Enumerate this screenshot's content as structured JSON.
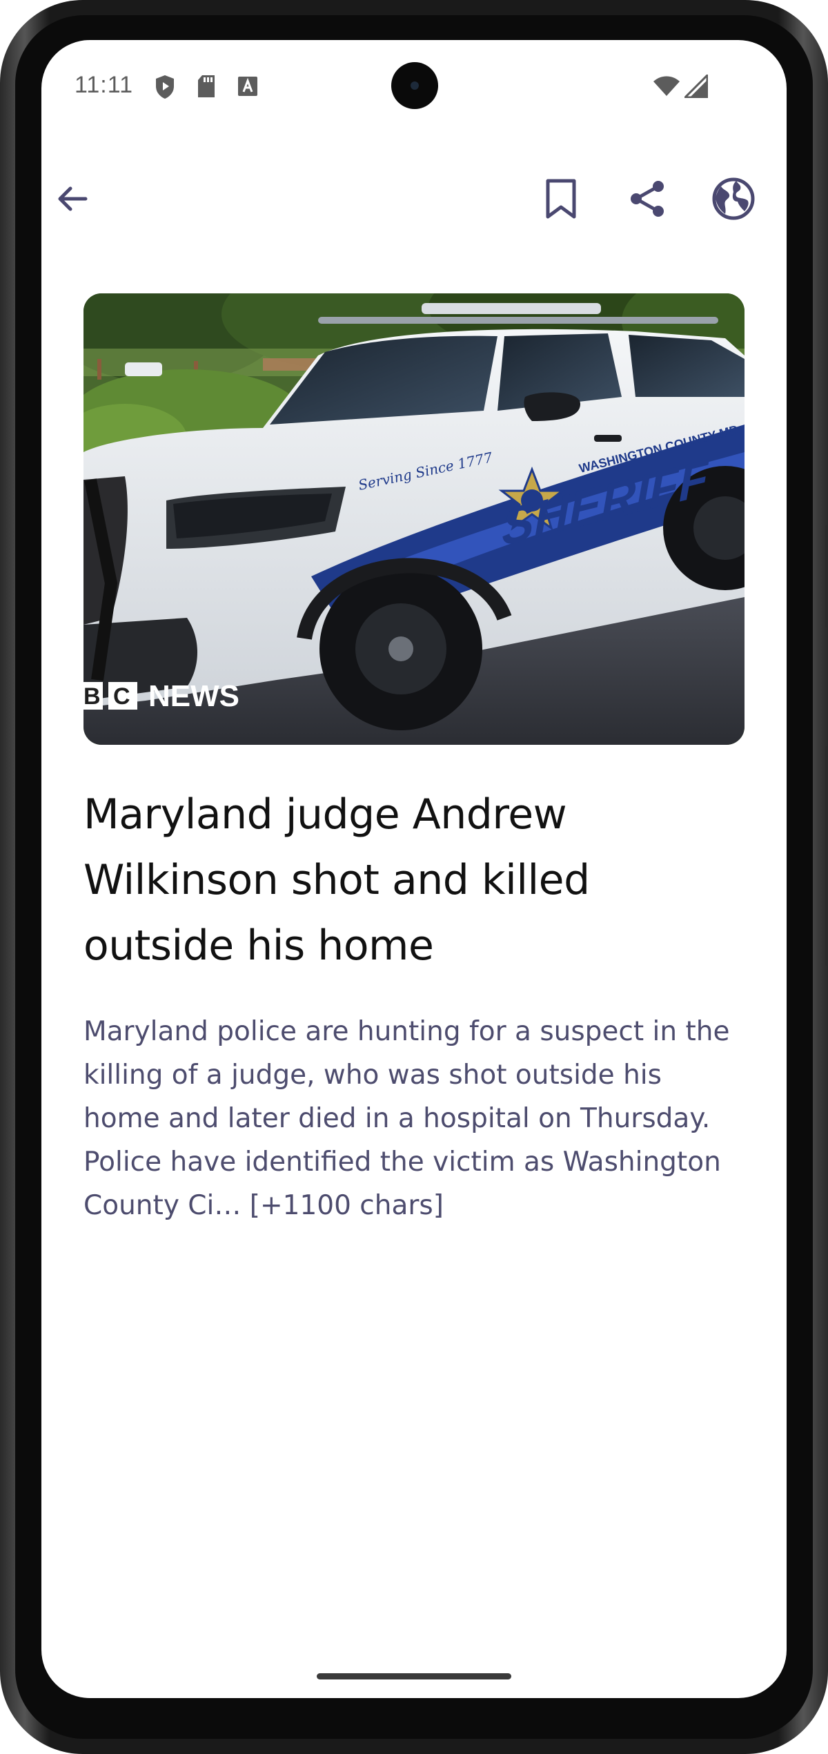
{
  "status_bar": {
    "time": "11:11",
    "left_icons": [
      "shield-icon",
      "sd-card-icon",
      "font-a-icon"
    ],
    "right_icons": [
      "wifi-icon",
      "cellular-signal-icon"
    ]
  },
  "app_bar": {
    "back_icon": "arrow-back-icon",
    "actions": [
      "bookmark-icon",
      "share-icon",
      "globe-icon"
    ]
  },
  "article": {
    "image_watermark": "B C NEWS",
    "image_badge_letters": [
      "B",
      "C"
    ],
    "image_badge_word": "NEWS",
    "car_text_serving": "Serving Since 1777",
    "car_text_county": "WASHINGTON COUNTY MD",
    "car_text_sheriff": "SHERIFF",
    "headline": "Maryland judge Andrew Wilkinson shot and killed outside his home",
    "body": "Maryland police are hunting for a suspect in the killing of a judge, who was shot outside his home and later died in a hospital on Thursday.\nPolice have identified the victim as Washington County Ci… [+1100 chars]"
  },
  "colors": {
    "icon": "#4a4870",
    "body_text": "#4d4c6e",
    "headline": "#111111",
    "background": "#ffffff"
  }
}
